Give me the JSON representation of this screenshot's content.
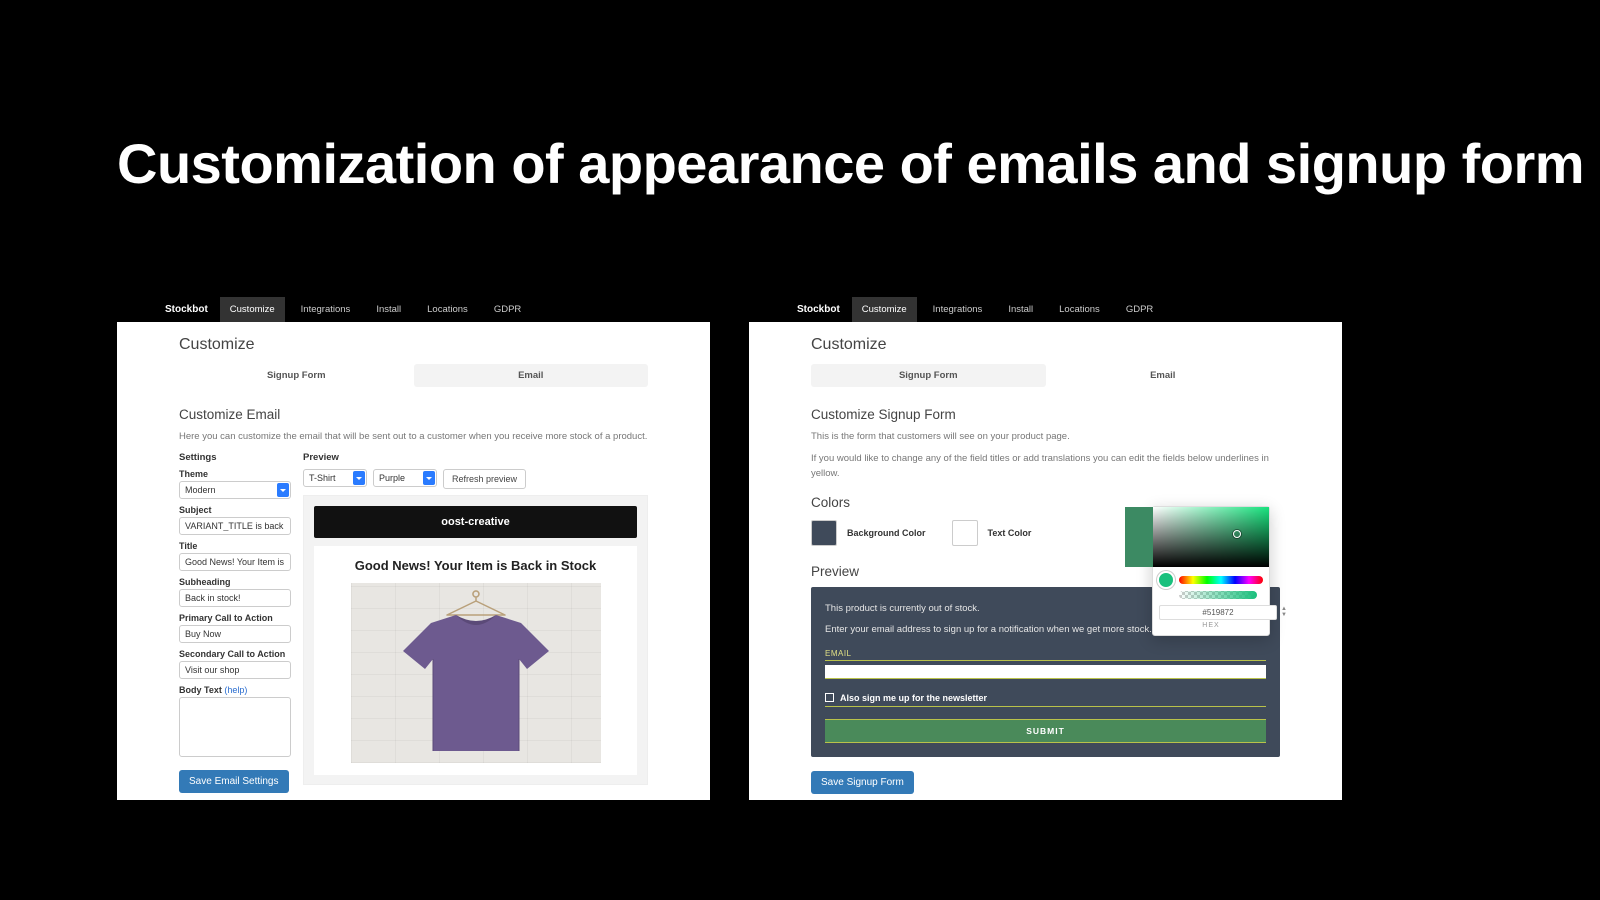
{
  "slide_title": "Customization of appearance of emails and signup form",
  "nav": {
    "brand": "Stockbot",
    "items": [
      "Customize",
      "Integrations",
      "Install",
      "Locations",
      "GDPR"
    ],
    "active": "Customize"
  },
  "left": {
    "page_title": "Customize",
    "subtabs": {
      "signup": "Signup Form",
      "email": "Email",
      "active": "email"
    },
    "section_title": "Customize Email",
    "section_help": "Here you can customize the email that will be sent out to a customer when you receive more stock of a product.",
    "settings_heading": "Settings",
    "preview_heading": "Preview",
    "fields": {
      "theme": {
        "label": "Theme",
        "value": "Modern"
      },
      "subject": {
        "label": "Subject",
        "value": "VARIANT_TITLE is back in stock"
      },
      "title": {
        "label": "Title",
        "value": "Good News! Your Item is Back in S"
      },
      "subheading": {
        "label": "Subheading",
        "value": "Back in stock!"
      },
      "primary_cta": {
        "label": "Primary Call to Action",
        "value": "Buy Now"
      },
      "secondary_cta": {
        "label": "Secondary Call to Action",
        "value": "Visit our shop"
      },
      "body": {
        "label": "Body Text",
        "help": "(help)",
        "value": ""
      }
    },
    "preview_toolbar": {
      "product": "T-Shirt",
      "variant": "Purple",
      "refresh": "Refresh preview"
    },
    "email_preview": {
      "store_name": "oost-creative",
      "headline": "Good News! Your Item is Back in Stock"
    },
    "save_button": "Save Email Settings"
  },
  "right": {
    "page_title": "Customize",
    "subtabs": {
      "signup": "Signup Form",
      "email": "Email",
      "active": "signup"
    },
    "section_title": "Customize Signup Form",
    "section_help_1": "This is the form that customers will see on your product page.",
    "section_help_2": "If you would like to change any of the field titles or add translations you can edit the fields below underlines in yellow.",
    "colors_heading": "Colors",
    "bg_label": "Background Color",
    "text_label": "Text Color",
    "bg_color": "#3f4a5a",
    "text_color": "#ffffff",
    "preview_heading": "Preview",
    "signup_preview": {
      "line1": "This product is currently out of stock.",
      "line2": "Enter your email address to sign up for a notification when we get more stock.",
      "email_label": "EMAIL",
      "newsletter_label": "Also sign me up for the newsletter",
      "submit": "SUBMIT"
    },
    "picker": {
      "preview_bar_color": "#3c8a63",
      "current_color": "#1ac07d",
      "hex_value": "#519872",
      "hex_caption": "HEX"
    },
    "save_button": "Save Signup Form"
  }
}
